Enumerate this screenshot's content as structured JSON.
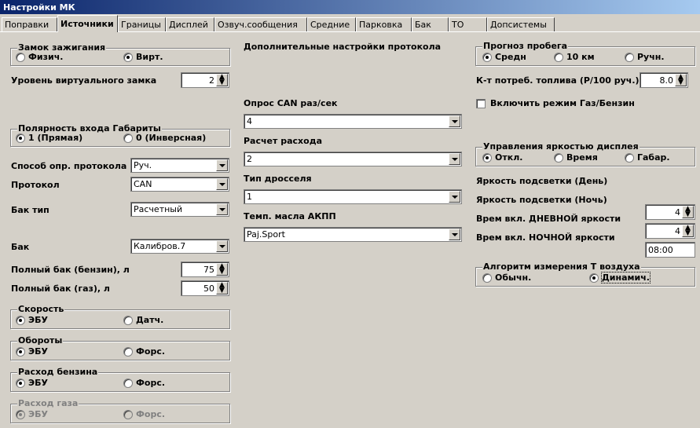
{
  "window": {
    "title": "Настройки МК"
  },
  "tabs": [
    {
      "label": "Поправки"
    },
    {
      "label": "Источники"
    },
    {
      "label": "Границы"
    },
    {
      "label": "Дисплей"
    },
    {
      "label": "Озвуч.сообщения"
    },
    {
      "label": "Средние"
    },
    {
      "label": "Парковка"
    },
    {
      "label": "Бак"
    },
    {
      "label": "ТО"
    },
    {
      "label": "Допсистемы"
    }
  ],
  "ignition": {
    "title": "Замок зажигания",
    "opt1": "Физич.",
    "opt2": "Вирт.",
    "selected": "Вирт."
  },
  "virtual_lock": {
    "label": "Уровень виртуального замка",
    "value": "2"
  },
  "polarity": {
    "title": "Полярность входа Габариты",
    "opt1": "1 (Прямая)",
    "opt2": "0 (Инверсная)",
    "selected": "1 (Прямая)"
  },
  "protocol_method": {
    "label": "Способ опр. протокола",
    "value": "Руч."
  },
  "protocol": {
    "label": "Протокол",
    "value": "CAN"
  },
  "tank_type": {
    "label": "Бак тип",
    "value": "Расчетный"
  },
  "tank": {
    "label": "Бак",
    "value": "Калибров.7"
  },
  "full_tank_petrol": {
    "label": "Полный бак (бензин), л",
    "value": "75"
  },
  "full_tank_gas": {
    "label": "Полный бак (газ), л",
    "value": "50"
  },
  "speed": {
    "title": "Скорость",
    "opt1": "ЭБУ",
    "opt2": "Датч.",
    "selected": "ЭБУ"
  },
  "rpm": {
    "title": "Обороты",
    "opt1": "ЭБУ",
    "opt2": "Форс.",
    "selected": "ЭБУ"
  },
  "fuel_consumption": {
    "title": "Расход бензина",
    "opt1": "ЭБУ",
    "opt2": "Форс.",
    "selected": "ЭБУ"
  },
  "gas_consumption": {
    "title": "Расход газа",
    "opt1": "ЭБУ",
    "opt2": "Форс.",
    "selected": "ЭБУ",
    "disabled": true
  },
  "protocol_extra": {
    "title": "Дополнительные настройки протокола"
  },
  "can_poll": {
    "label": "Опрос CAN раз/сек",
    "value": "4"
  },
  "consumption_calc": {
    "label": "Расчет расхода",
    "value": "2"
  },
  "throttle_type": {
    "label": "Тип дросселя",
    "value": "1"
  },
  "akpp_oil_temp": {
    "label": "Темп. масла АКПП",
    "value": "Paj.Sport"
  },
  "range_forecast": {
    "title": "Прогноз пробега",
    "opt1": "Средн",
    "opt2": "10 км",
    "opt3": "Ручн.",
    "selected": "Средн"
  },
  "fuel_coef": {
    "label": "К-т потреб. топлива (Р/100 руч.)",
    "value": "8.0"
  },
  "gas_petrol_mode": {
    "label": "Включить режим Газ/Бензин",
    "checked": false
  },
  "brightness_control": {
    "title": "Управления яркостью дисплея",
    "opt1": "Откл.",
    "opt2": "Время",
    "opt3": "Габар.",
    "selected": "Откл."
  },
  "brightness_day": {
    "label": "Яркость подсветки (День)"
  },
  "brightness_night": {
    "label": "Яркость подсветки (Ночь)"
  },
  "day_brightness_time": {
    "label": "Врем вкл. ДНЕВНОЙ яркости",
    "value": "4"
  },
  "night_brightness_time": {
    "label": "Врем вкл. НОЧНОЙ яркости",
    "value": "4"
  },
  "time_field": {
    "value": "08:00"
  },
  "air_temp_algo": {
    "title": "Алгоритм измерения Т воздуха",
    "opt1": "Обычн.",
    "opt2": "Динамич.",
    "selected": "Динамич."
  }
}
